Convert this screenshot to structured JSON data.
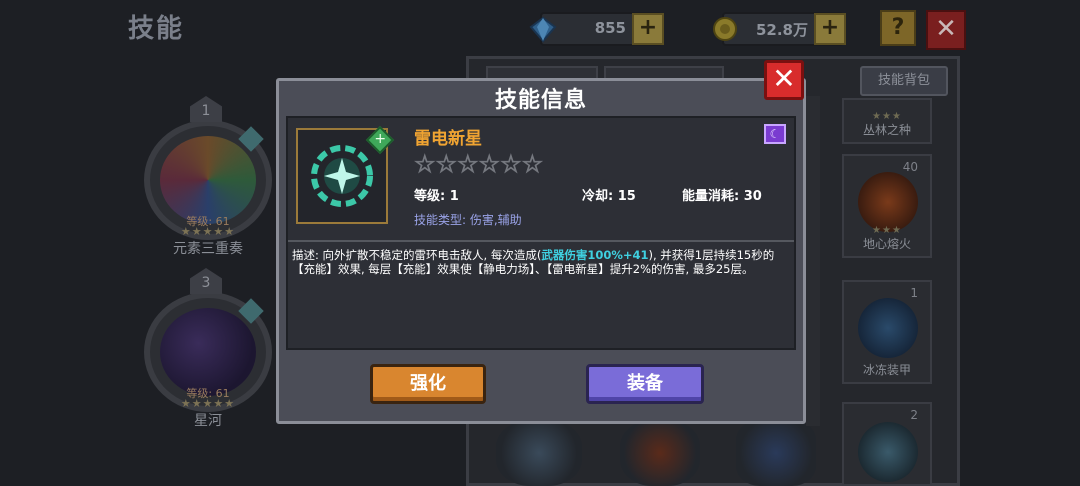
{
  "header": {
    "title": "技能",
    "gems": "855",
    "gold": "52.8万",
    "help_label": "?",
    "close_label": "✕"
  },
  "left_slots": [
    {
      "index": "1",
      "level": "等级: 61",
      "stars": "★★★★★",
      "name": "元素三重奏"
    },
    {
      "index": "3",
      "level": "等级: 61",
      "stars": "★★★★★",
      "name": "星河"
    }
  ],
  "right_panel": {
    "bag_button": "技能背包",
    "cells": [
      {
        "name": "丛林之种",
        "num": "",
        "stars": "★★★"
      },
      {
        "name": "地心熔火",
        "num": "40",
        "stars": "★★★"
      },
      {
        "name": "冰冻装甲",
        "num": "1",
        "stars": ""
      },
      {
        "name": "",
        "num": "2",
        "stars": ""
      }
    ]
  },
  "modal": {
    "title": "技能信息",
    "close_label": "✕",
    "skill_name": "雷电新星",
    "star_row": "☆☆☆☆☆☆",
    "level": "等级: 1",
    "cooldown": "冷却: 15",
    "energy": "能量消耗: 30",
    "skill_type": "技能类型: 伤害,辅助",
    "desc_pre": "描述: 向外扩散不稳定的雷环电击敌人, 每次造成(",
    "desc_highlight": "武器伤害100%+41",
    "desc_post": "), 并获得1层持续15秒的【充能】效果, 每层【充能】效果使【静电力场】、【雷电新星】提升2%的伤害, 最多25层。",
    "upgrade_label": "强化",
    "equip_label": "装备"
  }
}
